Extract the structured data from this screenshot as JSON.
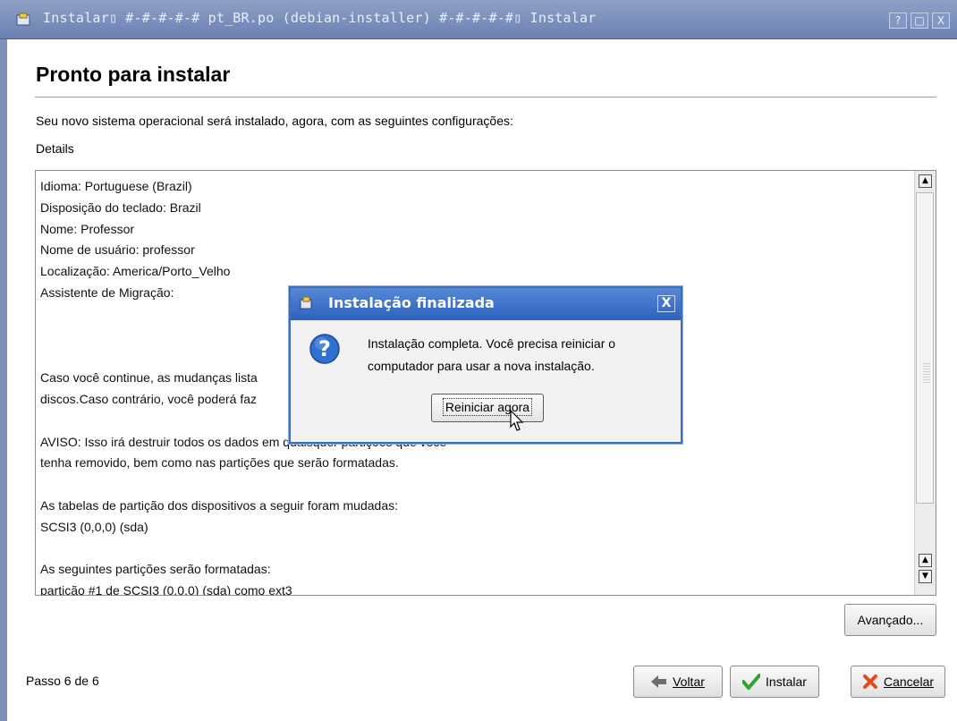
{
  "window": {
    "title": "Instalar▯ #-#-#-#-#  pt_BR.po (debian-installer)  #-#-#-#-#▯ Instalar",
    "help_button": "?",
    "maximize_button": "□",
    "close_button": "X"
  },
  "page": {
    "heading": "Pronto para instalar",
    "intro": "Seu novo sistema operacional será instalado, agora, com as seguintes configurações:",
    "details_label": "Details",
    "details_text": "Idioma: Portuguese (Brazil)\nDisposição do teclado: Brazil\nNome: Professor\nNome de usuário: professor\nLocalização: America/Porto_Velho\nAssistente de Migração:\n\n\n\nCaso você continue, as mudanças lista\ndiscos.Caso contrário, você poderá faz\n\nAVISO: Isso irá destruir todos os dados em quaisquer partições que você\ntenha removido, bem como nas partições que serão formatadas.\n\nAs tabelas de partição dos dispositivos a seguir foram mudadas:\nSCSI3 (0,0,0) (sda)\n\nAs seguintes partições serão formatadas:\npartição #1 de SCSI3 (0,0,0) (sda) como ext3"
  },
  "buttons": {
    "advanced": "Avançado...",
    "back": "Voltar",
    "install": "Instalar",
    "cancel": "Cancelar"
  },
  "status": {
    "step": "Passo 6 de 6"
  },
  "dialog": {
    "title": "Instalação finalizada",
    "close": "X",
    "message": "Instalação completa. Você precisa reiniciar o computador para usar a nova instalação.",
    "restart_button": "Reiniciar agora"
  },
  "colors": {
    "titlebar": "#7b8fbf",
    "dialog_titlebar": "#3c6fca",
    "question_icon": "#2f6fd0"
  }
}
